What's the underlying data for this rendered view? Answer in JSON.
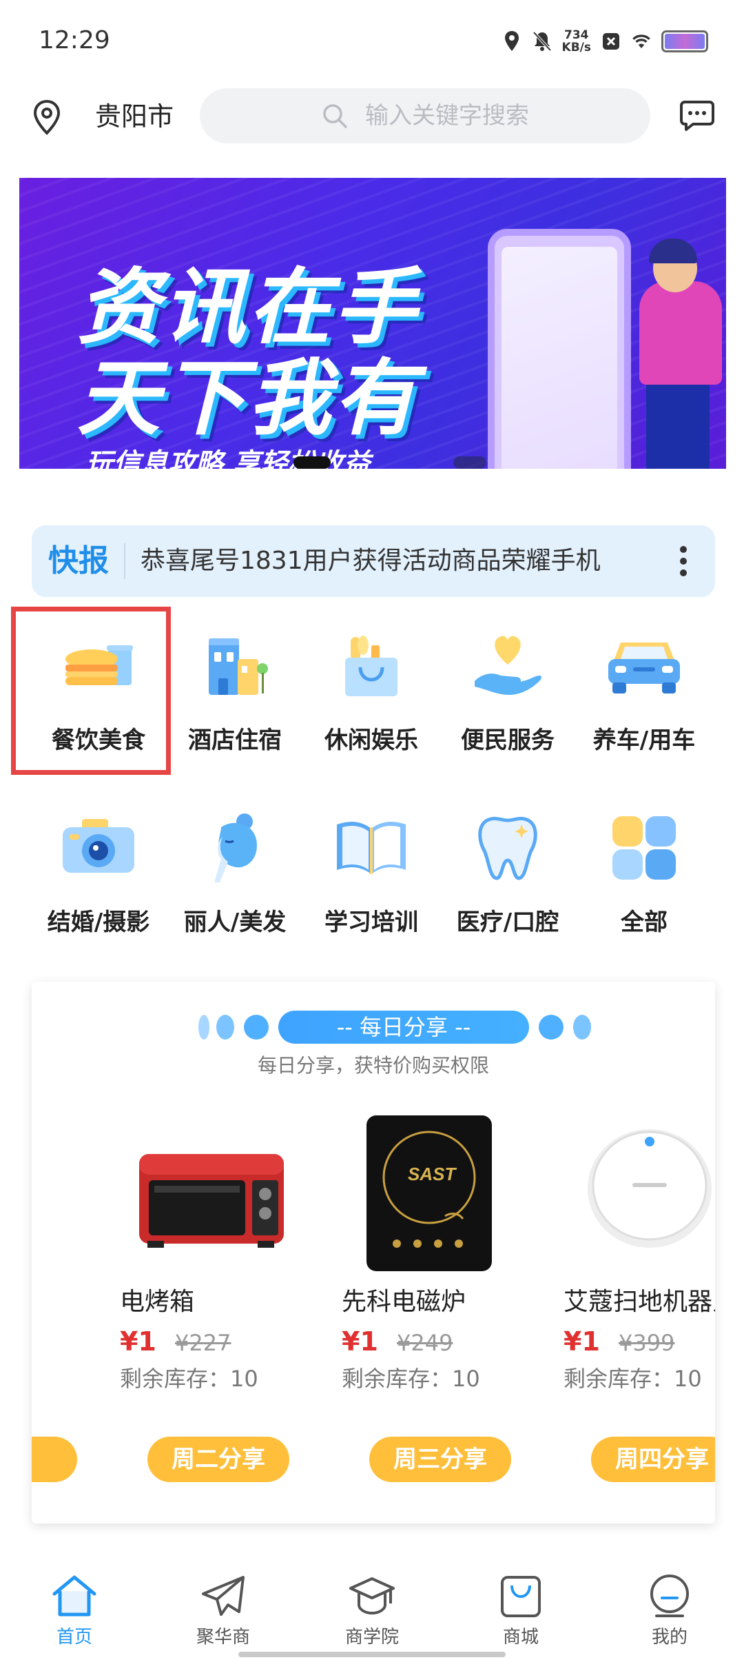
{
  "status_bar": {
    "time": "12:29",
    "net_speed_value": "734",
    "net_speed_unit": "KB/s"
  },
  "header": {
    "city": "贵阳市",
    "search_placeholder": "输入关键字搜索"
  },
  "banner": {
    "line1": "资讯在手",
    "line2": "天下我有",
    "subtitle": "玩信息攻略 享轻松收益"
  },
  "ticker": {
    "tag": "快报",
    "text": "恭喜尾号1831用户获得活动商品荣耀手机"
  },
  "categories": [
    {
      "label": "餐饮美食",
      "icon": "burger-drink-icon"
    },
    {
      "label": "酒店住宿",
      "icon": "hotel-icon"
    },
    {
      "label": "休闲娱乐",
      "icon": "shopping-bag-icon"
    },
    {
      "label": "便民服务",
      "icon": "heart-hand-icon"
    },
    {
      "label": "养车/用车",
      "icon": "car-icon"
    },
    {
      "label": "结婚/摄影",
      "icon": "camera-icon"
    },
    {
      "label": "丽人/美发",
      "icon": "beauty-hair-icon"
    },
    {
      "label": "学习培训",
      "icon": "book-icon"
    },
    {
      "label": "医疗/口腔",
      "icon": "tooth-icon"
    },
    {
      "label": "全部",
      "icon": "grid-all-icon"
    }
  ],
  "share": {
    "title": "-- 每日分享 --",
    "subtitle": "每日分享，获特价购买权限",
    "products": [
      {
        "name": "电烤箱",
        "price": "¥1",
        "old_price": "¥227",
        "stock": "剩余库存：10",
        "button": "周二分享"
      },
      {
        "name": "先科电磁炉",
        "price": "¥1",
        "old_price": "¥249",
        "stock": "剩余库存：10",
        "button": "周三分享"
      },
      {
        "name": "艾蔻扫地机器人",
        "price": "¥1",
        "old_price": "¥399",
        "stock": "剩余库存：10",
        "button": "周四分享"
      }
    ]
  },
  "bottom_nav": [
    {
      "label": "首页",
      "icon": "home-icon",
      "active": true
    },
    {
      "label": "聚华商",
      "icon": "paper-plane-icon",
      "active": false
    },
    {
      "label": "商学院",
      "icon": "graduation-cap-icon",
      "active": false
    },
    {
      "label": "商城",
      "icon": "shopping-bag-icon",
      "active": false
    },
    {
      "label": "我的",
      "icon": "profile-icon",
      "active": false
    }
  ],
  "colors": {
    "accent": "#2196f3",
    "price_red": "#e03030",
    "share_button": "#ffbf3a",
    "highlight_box": "#e64545"
  }
}
